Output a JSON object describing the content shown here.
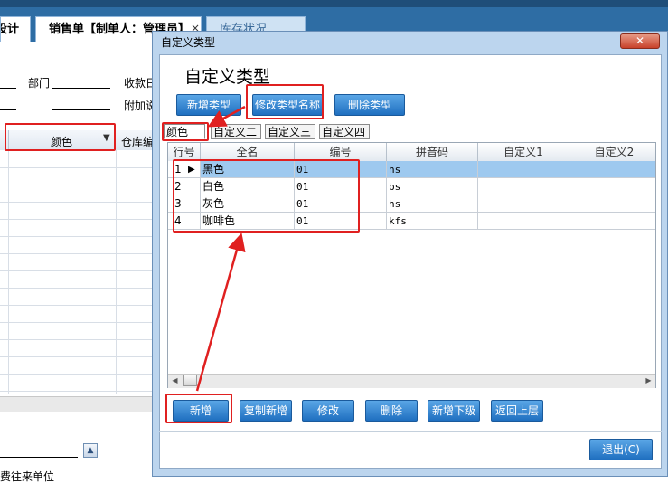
{
  "background_app": {
    "tabs": [
      {
        "label": "设计"
      },
      {
        "label": "销售单【制单人：管理员】"
      },
      {
        "label": "库存状况"
      }
    ],
    "tab_close": "×",
    "form_labels": {
      "dept": "部门",
      "receipt": "收款日",
      "attach": "附加说"
    },
    "grid_headers": {
      "color": "颜色",
      "warehouse": "仓库编"
    },
    "footer_label": "费往来单位"
  },
  "dialog": {
    "title": "自定义类型",
    "close_label": "✕",
    "heading": "自定义类型",
    "top_buttons": {
      "new_type": "新增类型",
      "rename_type": "修改类型名称",
      "delete_type": "删除类型"
    },
    "type_tabs": [
      {
        "label": "颜色"
      },
      {
        "label": "自定义二"
      },
      {
        "label": "自定义三"
      },
      {
        "label": "自定义四"
      }
    ],
    "table": {
      "columns": [
        "行号",
        "全名",
        "编号",
        "拼音码",
        "自定义1",
        "自定义2"
      ],
      "rows": [
        {
          "no": "1",
          "name": "黑色",
          "code": "01",
          "pinyin": "hs"
        },
        {
          "no": "2",
          "name": "白色",
          "code": "01",
          "pinyin": "bs"
        },
        {
          "no": "3",
          "name": "灰色",
          "code": "01",
          "pinyin": "hs"
        },
        {
          "no": "4",
          "name": "咖啡色",
          "code": "01",
          "pinyin": "kfs"
        }
      ],
      "selected_row": 0
    },
    "bottom_buttons": {
      "add": "新增",
      "copy_add": "复制新增",
      "modify": "修改",
      "delete": "删除",
      "add_sub": "新增下级",
      "back_up": "返回上层"
    },
    "exit_label": "退出(C)"
  },
  "colors": {
    "annotation_red": "#e02020",
    "button_blue": "#1f6fc0",
    "selection_blue": "#9ec9ef",
    "dialog_frame": "#bcd5ee"
  }
}
